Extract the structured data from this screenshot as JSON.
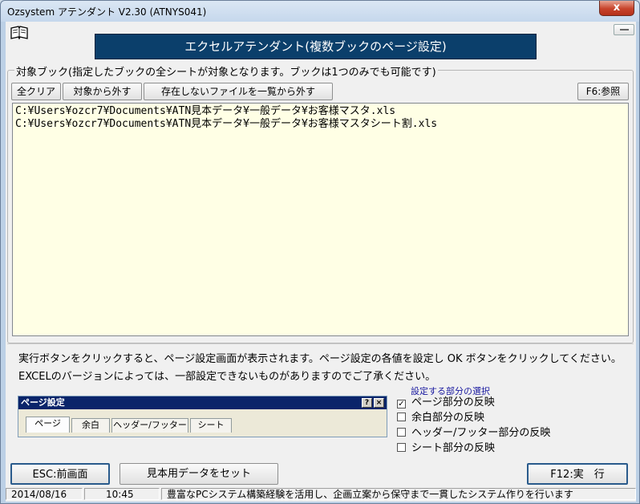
{
  "window": {
    "title": "Ozsystem アテンダント V2.30 (ATNYS041)",
    "close_glyph": "x"
  },
  "banner": {
    "title": "エクセルアテンダント(複数ブックのページ設定)"
  },
  "target_group": {
    "label": "対象ブック(指定したブックの全シートが対象となります。ブックは1つのみでも可能です)",
    "buttons": {
      "clear_all": "全クリア",
      "remove_selected": "対象から外す",
      "remove_missing": "存在しないファイルを一覧から外す",
      "browse": "F6:参照"
    },
    "files": [
      "C:¥Users¥ozcr7¥Documents¥ATN見本データ¥一般データ¥お客様マスタ.xls",
      "C:¥Users¥ozcr7¥Documents¥ATN見本データ¥一般データ¥お客様マスタシート割.xls"
    ]
  },
  "info": {
    "line1": "実行ボタンをクリックすると、ページ設定画面が表示されます。ページ設定の各値を設定し OK ボタンをクリックしてください。",
    "line2": "EXCELのバージョンによっては、一部設定できないものがありますのでご了承ください。"
  },
  "page_setup_preview": {
    "title": "ページ設定",
    "help_glyph": "?",
    "close_glyph": "×",
    "tabs": [
      "ページ",
      "余白",
      "ヘッダー/フッター",
      "シート"
    ]
  },
  "options": {
    "title": "設定する部分の選択",
    "check_glyph": "✓",
    "items": [
      {
        "label": "ページ部分の反映",
        "checked": true
      },
      {
        "label": "余白部分の反映",
        "checked": false
      },
      {
        "label": "ヘッダー/フッター部分の反映",
        "checked": false
      },
      {
        "label": "シート部分の反映",
        "checked": false
      }
    ]
  },
  "actions": {
    "back": "ESC:前画面",
    "set_sample": "見本用データをセット",
    "execute": "F12:実　行"
  },
  "status": {
    "date": "2014/08/16",
    "time": "10:45",
    "message": "豊富なPCシステム構築経験を活用し、企画立案から保守まで一貫したシステム作りを行います"
  }
}
